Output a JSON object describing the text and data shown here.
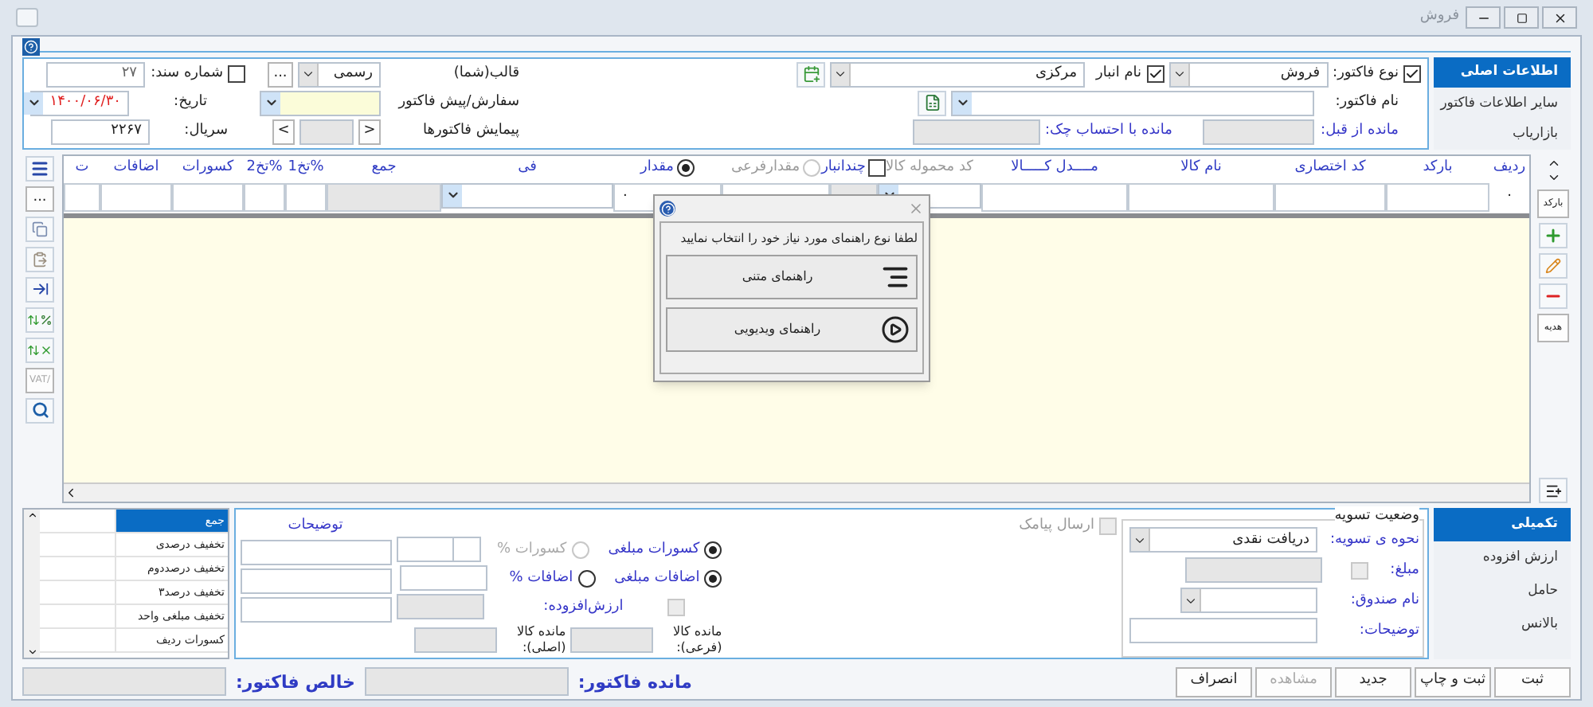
{
  "window": {
    "title": "فروش"
  },
  "main_tabs": [
    {
      "label": "اطلاعات اصلی",
      "selected": true
    },
    {
      "label": "سایر اطلاعات فاکتور",
      "selected": false
    },
    {
      "label": "بازاریاب",
      "selected": false
    }
  ],
  "invoice_type": {
    "label": "نوع فاکتور:",
    "checked": true,
    "value": "فروش"
  },
  "warehouse": {
    "label": "نام انبار",
    "checked": true,
    "value": "مرکزی"
  },
  "invoice_name": {
    "label": "نام فاکتور:"
  },
  "prev_balance": {
    "label": "مانده از قبل:"
  },
  "balance_with_checks": {
    "label": "مانده با احتساب چک:"
  },
  "template": {
    "label": "قالب(شما)",
    "value": "رسمی",
    "more": "..."
  },
  "doc_number": {
    "label": "شماره سند:",
    "checked": false,
    "value": "۲۷"
  },
  "order": {
    "label": "سفارش/پیش فاکتور"
  },
  "date": {
    "label": "تاریخ:",
    "value": "۱۴۰۰/۰۶/۳۰"
  },
  "navigate": {
    "label": "پیمایش فاکتورها",
    "prev": "<",
    "next": ">"
  },
  "serial": {
    "label": "سریال:",
    "value": "۲۲۶۷"
  },
  "side_buttons": {
    "barcode": "بارکد",
    "gift": "هدیه"
  },
  "left_tools": {
    "more": "...",
    "vat": "/VAT"
  },
  "grid": {
    "columns": [
      {
        "label": "ردیف",
        "kind": "text",
        "disabled": false,
        "cell": {
          "kind": "plain",
          "value": "۰"
        }
      },
      {
        "label": "بارکد",
        "kind": "text",
        "disabled": false,
        "cell": {
          "kind": "input"
        }
      },
      {
        "label": "کد اختصاری",
        "kind": "text",
        "disabled": false,
        "cell": {
          "kind": "input"
        }
      },
      {
        "label": "نام کالا",
        "kind": "text",
        "disabled": false,
        "cell": {
          "kind": "input"
        }
      },
      {
        "label": "مــــدل کـــــالا",
        "kind": "text",
        "disabled": false,
        "cell": {
          "kind": "input"
        }
      },
      {
        "label": "کد محموله کالا",
        "kind": "text",
        "disabled": true,
        "cell": {
          "kind": "dropdown"
        }
      },
      {
        "label": "چندانبار",
        "kind": "checkbox",
        "checked": false,
        "disabled": false,
        "cell": {
          "kind": "readonly"
        }
      },
      {
        "label": "مقدارفرعی",
        "kind": "radio",
        "selected": false,
        "disabled": true,
        "cell": {
          "kind": "input"
        }
      },
      {
        "label": "مقدار",
        "kind": "radio",
        "selected": true,
        "disabled": false,
        "cell": {
          "kind": "input",
          "value": "۰"
        }
      },
      {
        "label": "فی",
        "kind": "text",
        "disabled": false,
        "cell": {
          "kind": "dropdown"
        }
      },
      {
        "label": "جمع",
        "kind": "text",
        "disabled": false,
        "cell": {
          "kind": "readonly"
        }
      },
      {
        "label": "%تخ1",
        "kind": "text",
        "disabled": false,
        "cell": {
          "kind": "input"
        }
      },
      {
        "label": "%تخ2",
        "kind": "text",
        "disabled": false,
        "cell": {
          "kind": "input"
        }
      },
      {
        "label": "کسورات",
        "kind": "text",
        "disabled": false,
        "cell": {
          "kind": "input"
        }
      },
      {
        "label": "اضافات",
        "kind": "text",
        "disabled": false,
        "cell": {
          "kind": "input"
        }
      },
      {
        "label": "ت",
        "kind": "text",
        "disabled": false,
        "cell": {
          "kind": "input"
        }
      }
    ]
  },
  "dialog": {
    "message": "لطفا نوع راهنمای مورد نیاز خود را انتخاب نمایید",
    "options": [
      {
        "label": "راهنمای متنی",
        "kind": "text"
      },
      {
        "label": "راهنمای ویدیویی",
        "kind": "video"
      }
    ]
  },
  "bottom_tabs": [
    {
      "label": "تکمیلی",
      "selected": true
    },
    {
      "label": "ارزش افزوده",
      "selected": false
    },
    {
      "label": "حامل",
      "selected": false
    },
    {
      "label": "بالانس",
      "selected": false
    }
  ],
  "summary_list": [
    {
      "label": "جمع",
      "selected": true
    },
    {
      "label": "تخفیف درصدی",
      "selected": false
    },
    {
      "label": "تخفیف درصددوم",
      "selected": false
    },
    {
      "label": "تخفیف درصد۳",
      "selected": false
    },
    {
      "label": "تخفیف مبلغی واحد",
      "selected": false
    },
    {
      "label": "کسورات ردیف",
      "selected": false
    }
  ],
  "extras": {
    "notes_header": "توضیحات",
    "deduction_amount": {
      "label": "کسورات مبلغی",
      "selected": true,
      "disabled": false
    },
    "deduction_percent": {
      "label": "کسورات %",
      "selected": false,
      "disabled": true
    },
    "addition_amount": {
      "label": "اضافات مبلغی",
      "selected": true,
      "disabled": false
    },
    "addition_percent": {
      "label": "اضافات %",
      "selected": false,
      "disabled": false
    },
    "vat": {
      "label": "ارزش‌افزوده:",
      "checked": false,
      "disabled": true
    },
    "remain_sub": [
      "مانده کالا",
      "(فرعی):"
    ],
    "remain_main": [
      "مانده کالا",
      "(اصلی):"
    ]
  },
  "sms": {
    "label": "ارسال پیامک",
    "checked": false,
    "disabled": true
  },
  "settlement": {
    "title": "وضعیت تسویه",
    "method": {
      "label": "نحوه ی تسویه:",
      "value": "دریافت نقدی"
    },
    "amount": {
      "label": "مبلغ:",
      "checked": false,
      "disabled": true
    },
    "cashbox": {
      "label": "نام صندوق:"
    },
    "notes": {
      "label": "توضیحات:"
    }
  },
  "buttons": [
    {
      "label": "ثبت",
      "disabled": false
    },
    {
      "label": "ثبت و چاپ",
      "disabled": false
    },
    {
      "label": "جدید",
      "disabled": false
    },
    {
      "label": "مشاهده",
      "disabled": true
    },
    {
      "label": "انصراف",
      "disabled": false
    }
  ],
  "invoice_remaining": {
    "label": "مانده فاکتور:"
  },
  "net_invoice": {
    "label": "خالص فاکتور:"
  }
}
